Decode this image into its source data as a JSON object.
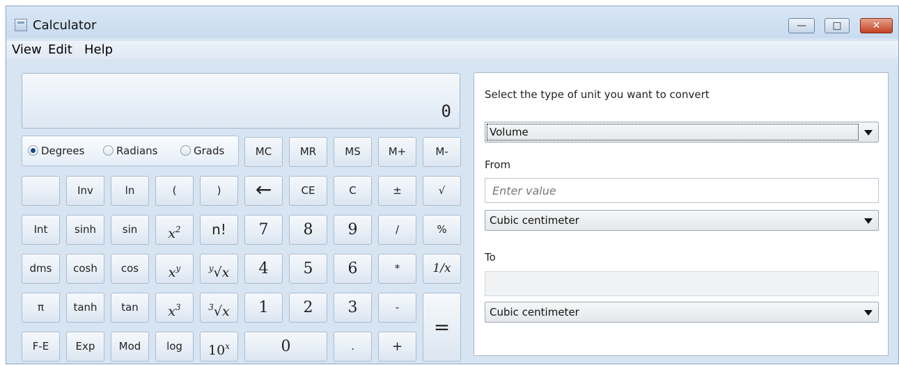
{
  "window": {
    "title": "Calculator",
    "min_glyph": "—",
    "max_glyph": "□",
    "close_glyph": "✕"
  },
  "menu": [
    "View",
    "Edit",
    "Help"
  ],
  "display": {
    "value": "0"
  },
  "angle": {
    "options": [
      "Degrees",
      "Radians",
      "Grads"
    ],
    "selected": "Degrees"
  },
  "buttons": {
    "row0": [
      "MC",
      "MR",
      "MS",
      "M+",
      "M-"
    ],
    "row1": [
      "",
      "Inv",
      "ln",
      "(",
      ")",
      "←",
      "CE",
      "C",
      "±",
      "√"
    ],
    "row2": [
      "Int",
      "sinh",
      "sin",
      "x2",
      "n!",
      "7",
      "8",
      "9",
      "/",
      "%"
    ],
    "row3": [
      "dms",
      "cosh",
      "cos",
      "xy",
      "y√x",
      "4",
      "5",
      "6",
      "*",
      "1/x"
    ],
    "row4": [
      "π",
      "tanh",
      "tan",
      "x3",
      "3√x",
      "1",
      "2",
      "3",
      "-",
      "="
    ],
    "row5": [
      "F-E",
      "Exp",
      "Mod",
      "log",
      "10x",
      "0",
      ".",
      "+"
    ]
  },
  "converter": {
    "prompt": "Select the type of unit you want to convert",
    "type_value": "Volume",
    "from_label": "From",
    "from_placeholder": "Enter value",
    "from_unit": "Cubic centimeter",
    "to_label": "To",
    "to_value": "",
    "to_unit": "Cubic centimeter"
  }
}
